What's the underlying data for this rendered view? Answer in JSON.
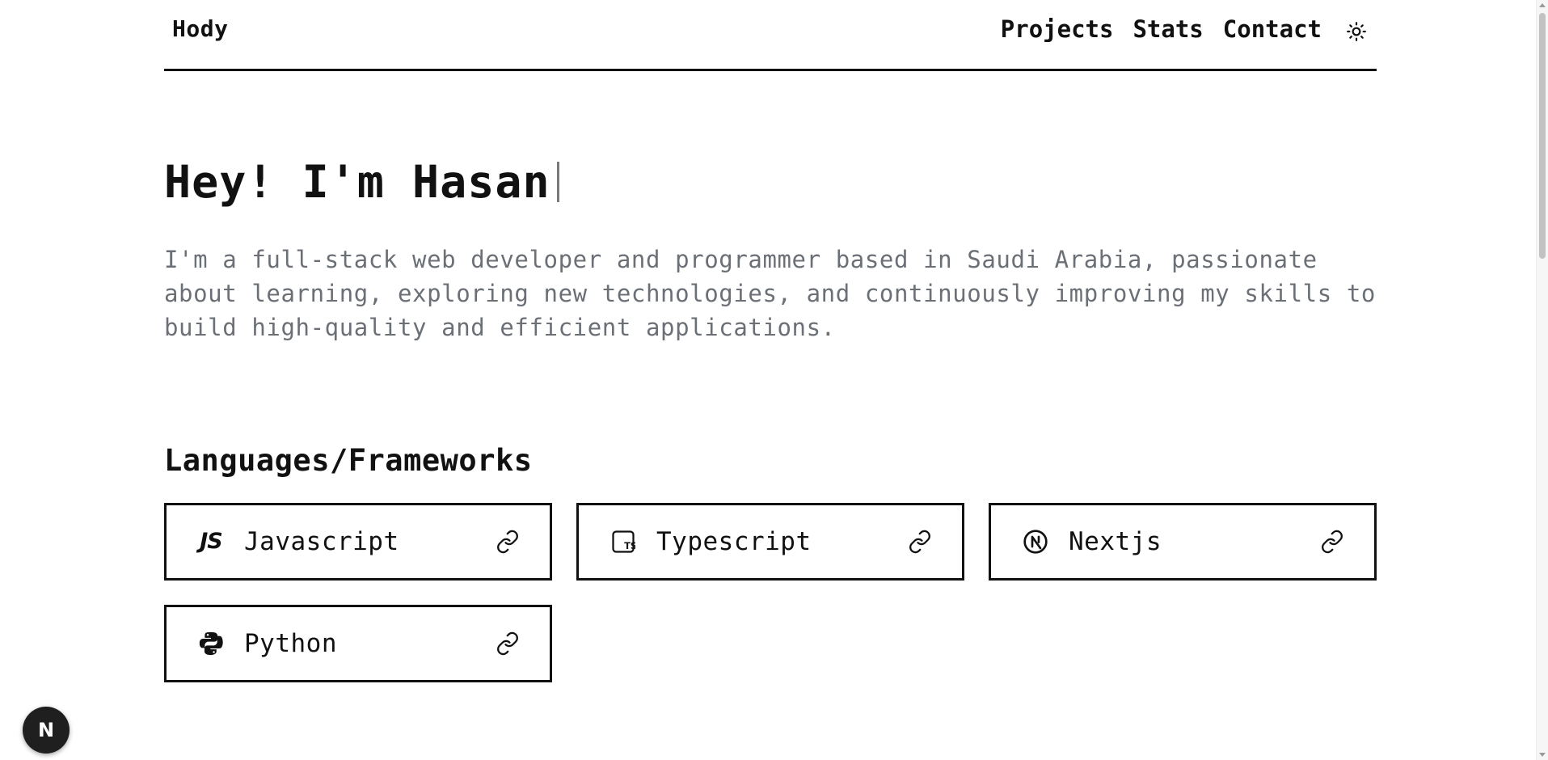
{
  "header": {
    "brand": "Hody",
    "nav": [
      {
        "label": "Projects"
      },
      {
        "label": "Stats"
      },
      {
        "label": "Contact"
      }
    ],
    "theme_icon": "sun-icon"
  },
  "hero": {
    "title": "Hey! I'm Hasan",
    "intro": "I'm a full-stack web developer and programmer based in Saudi Arabia, passionate about learning, exploring new technologies, and continuously improving my skills to build high-quality and efficient applications."
  },
  "skills": {
    "title": "Languages/Frameworks",
    "items": [
      {
        "label": "Javascript",
        "icon": "javascript-icon",
        "icon_text": "JS"
      },
      {
        "label": "Typescript",
        "icon": "typescript-icon",
        "icon_text": "TS"
      },
      {
        "label": "Nextjs",
        "icon": "nextjs-icon",
        "icon_text": "N"
      },
      {
        "label": "Python",
        "icon": "python-icon",
        "icon_text": ""
      }
    ],
    "link_icon": "link-icon"
  },
  "dev_badge": {
    "icon": "nextjs-dev-indicator-icon",
    "letter": "N"
  },
  "colors": {
    "text": "#111111",
    "muted": "#6b6f76",
    "background": "#ffffff",
    "badge": "#1f1f1f"
  }
}
